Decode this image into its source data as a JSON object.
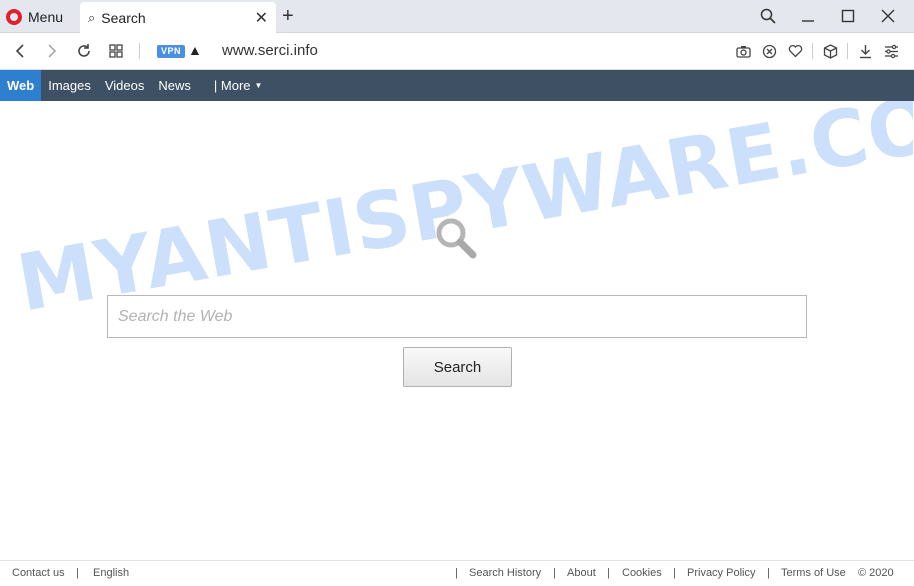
{
  "browser": {
    "menu_label": "Menu",
    "tab_title": "Search",
    "url": "www.serci.info",
    "vpn_badge": "VPN",
    "accent_color": "#e0202b"
  },
  "nav": {
    "items": [
      "Web",
      "Images",
      "Videos",
      "News"
    ],
    "active": "Web",
    "more_label": "| More"
  },
  "search": {
    "placeholder": "Search the Web",
    "button_label": "Search"
  },
  "watermark": "MYANTISPYWARE.COM",
  "footer": {
    "left": [
      "Contact us",
      "English"
    ],
    "right": [
      "Search History",
      "About",
      "Cookies",
      "Privacy Policy",
      "Terms of Use"
    ],
    "copyright": "© 2020",
    "separator": "|"
  }
}
